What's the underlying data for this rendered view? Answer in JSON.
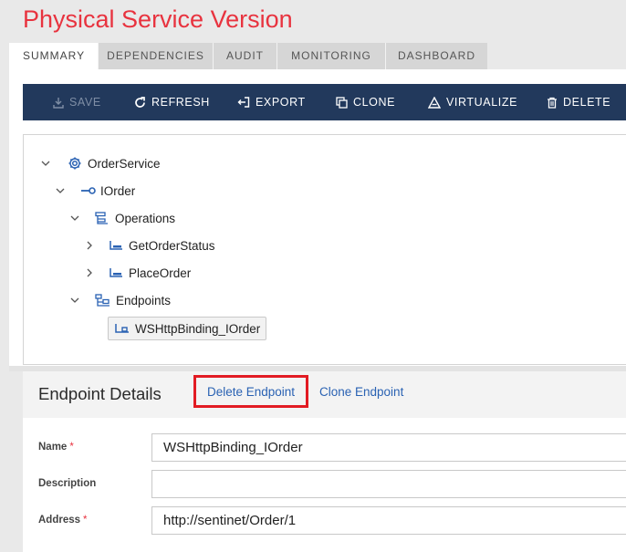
{
  "page": {
    "title": "Physical Service Version"
  },
  "tabs": [
    {
      "label": "SUMMARY",
      "active": true
    },
    {
      "label": "DEPENDENCIES",
      "active": false
    },
    {
      "label": "AUDIT",
      "active": false
    },
    {
      "label": "MONITORING",
      "active": false
    },
    {
      "label": "DASHBOARD",
      "active": false
    }
  ],
  "toolbar": {
    "save": "SAVE",
    "refresh": "REFRESH",
    "export": "EXPORT",
    "clone": "CLONE",
    "virtualize": "VIRTUALIZE",
    "delete": "DELETE"
  },
  "tree": {
    "service": "OrderService",
    "contract": "IOrder",
    "operations": "Operations",
    "op1": "GetOrderStatus",
    "op2": "PlaceOrder",
    "endpoints": "Endpoints",
    "endpoint1": "WSHttpBinding_IOrder"
  },
  "details": {
    "title": "Endpoint Details",
    "delete_link": "Delete Endpoint",
    "clone_link": "Clone Endpoint"
  },
  "form": {
    "name_label": "Name",
    "name_value": "WSHttpBinding_IOrder",
    "description_label": "Description",
    "description_value": "",
    "address_label": "Address",
    "address_value": "http://sentinet/Order/1",
    "required_mark": "*"
  },
  "colors": {
    "title": "#e8333f",
    "toolbar_bg": "#22395c",
    "link": "#2a62b3",
    "highlight_border": "#e21b23"
  }
}
